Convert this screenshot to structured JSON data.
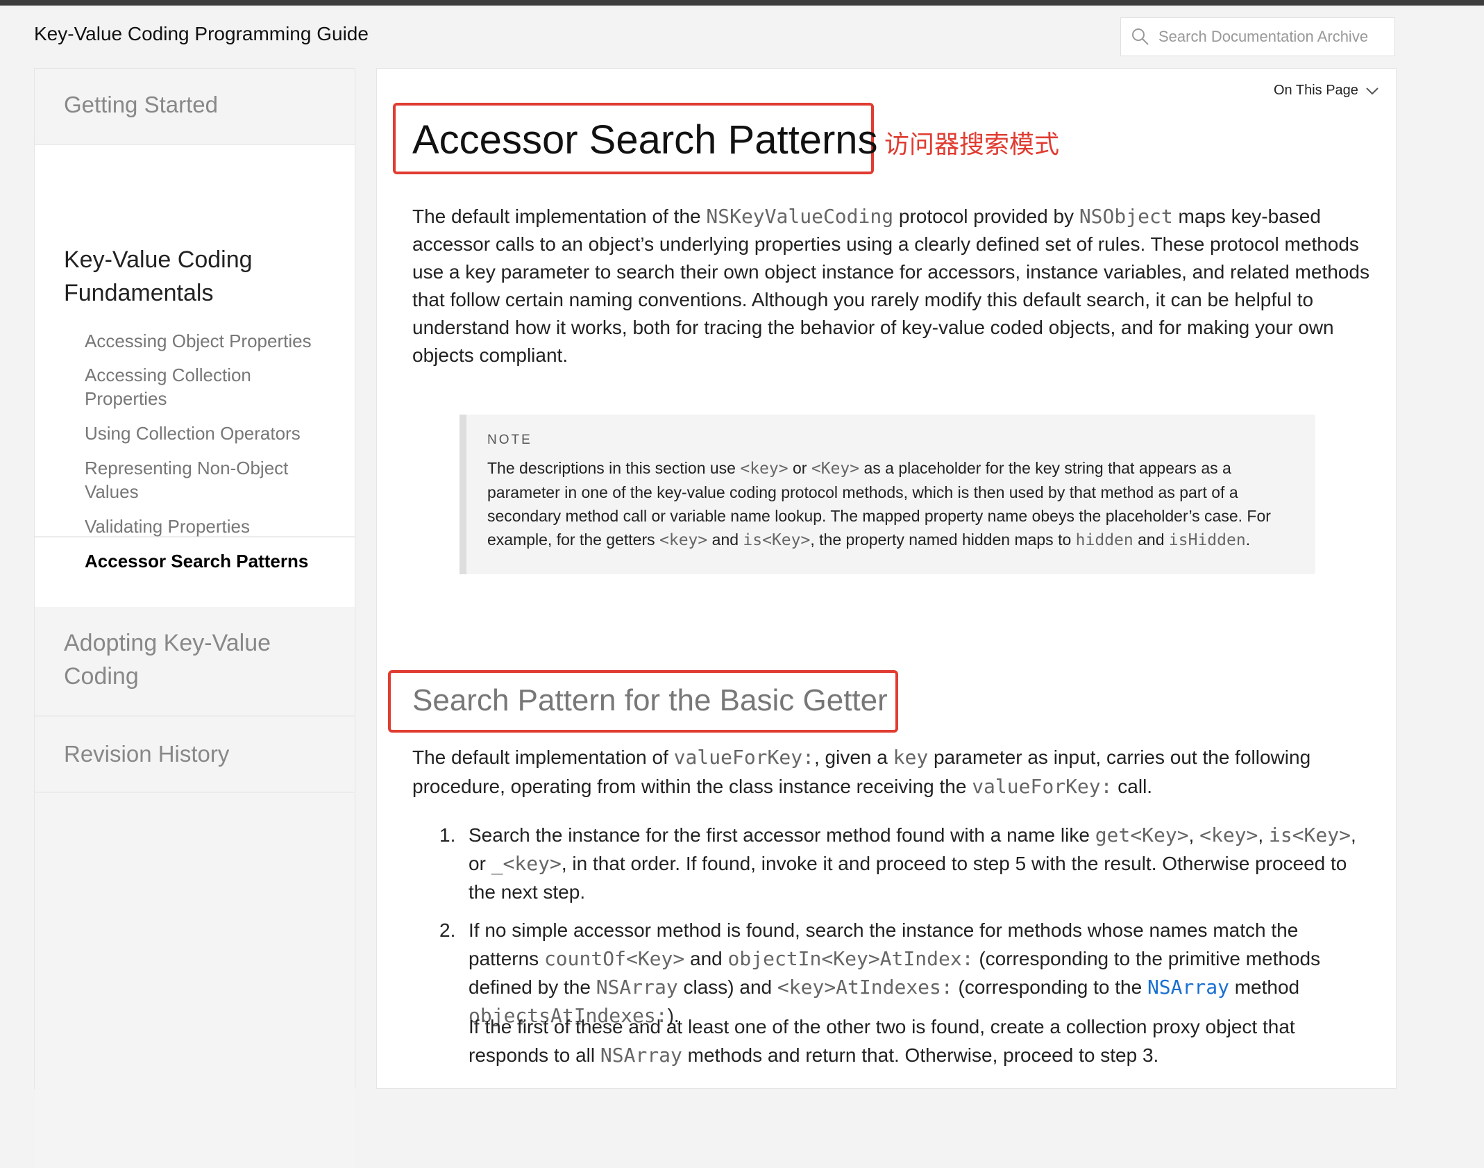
{
  "header": {
    "title": "Key-Value Coding Programming Guide",
    "search_placeholder": "Search Documentation Archive"
  },
  "sidebar": {
    "getting_started": "Getting Started",
    "fundamentals": "Key-Value Coding Fundamentals",
    "sub_items": [
      "Accessing Object Properties",
      "Accessing Collection Properties",
      "Using Collection Operators",
      "Representing Non-Object Values",
      "Validating Properties",
      "Accessor Search Patterns"
    ],
    "adopting": "Adopting Key-Value Coding",
    "revision": "Revision History"
  },
  "main": {
    "on_this_page": "On This Page",
    "title": "Accessor Search Patterns",
    "annotation": "访问器搜索模式",
    "intro": {
      "t1": "The default implementation of the ",
      "c1": "NSKeyValueCoding",
      "t2": " protocol provided by ",
      "c2": "NSObject",
      "t3": " maps key-based accessor calls to an object’s underlying properties using a clearly defined set of rules. These protocol methods use a key parameter to search their own object instance for accessors, instance variables, and related methods that follow certain naming conventions. Although you rarely modify this default search, it can be helpful to understand how it works, both for tracing the behavior of key-value coded objects, and for making your own objects compliant."
    },
    "note": {
      "label": "NOTE",
      "t1": "The descriptions in this section use ",
      "c1": "<key>",
      "t2": " or ",
      "c2": "<Key>",
      "t3": " as a placeholder for the key string that appears as a parameter in one of the key-value coding protocol methods, which is then used by that method as part of a secondary method call or variable name lookup. The mapped property name obeys the placeholder’s case. For example, for the getters ",
      "c3": "<key>",
      "t4": " and ",
      "c4": "is<Key>",
      "t5": ", the property named hidden maps to ",
      "c5": "hidden",
      "t6": " and ",
      "c6": "isHidden",
      "t7": "."
    },
    "section_title": "Search Pattern for the Basic Getter",
    "section_intro": {
      "t1": "The default implementation of ",
      "c1": "valueForKey:",
      "t2": ", given a ",
      "c2": "key",
      "t3": " parameter as input, carries out the following procedure, operating from within the class instance receiving the ",
      "c3": "valueForKey:",
      "t4": " call."
    },
    "step1": {
      "num": "1.",
      "t1": "Search the instance for the first accessor method found with a name like ",
      "c1": "get<Key>",
      "t2": ", ",
      "c2": "<key>",
      "t3": ", ",
      "c3": "is<Key>",
      "t4": ", or ",
      "c4": "_<key>",
      "t5": ", in that order. If found, invoke it and proceed to step 5 with the result. Otherwise proceed to the next step."
    },
    "step2": {
      "num": "2.",
      "t1": "If no simple accessor method is found, search the instance for methods whose names match the patterns ",
      "c1": "countOf<Key>",
      "t2": " and ",
      "c2": "objectIn<Key>AtIndex:",
      "t3": " (corresponding to the primitive methods defined by the ",
      "c3": "NSArray",
      "t4": " class) and ",
      "c4": "<key>AtIndexes:",
      "t5": " (corresponding to the ",
      "l1": "NSArray",
      "t6": " method ",
      "c5": "objectsAtIndexes:",
      "t7": ").",
      "p2_t1": "If the first of these and at least one of the other two is found, create a collection proxy object that responds to all ",
      "p2_c1": "NSArray",
      "p2_t2": " methods and return that. Otherwise, proceed to step 3."
    }
  }
}
